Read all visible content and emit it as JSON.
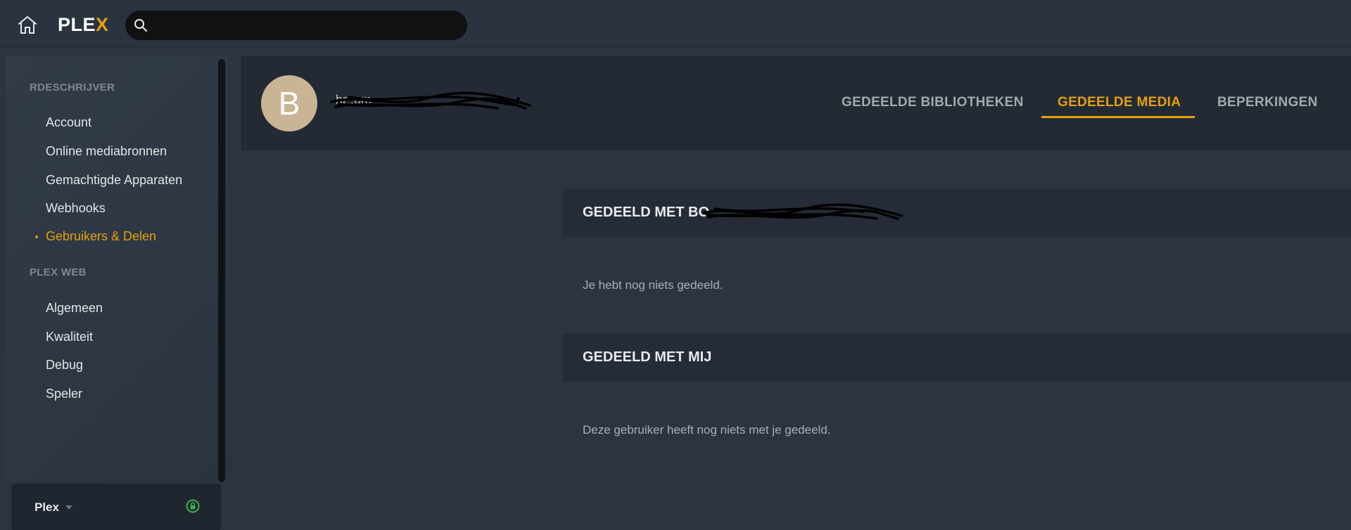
{
  "topbar": {
    "home_icon": "home-icon",
    "logo_text": "PLE",
    "logo_accent": "X",
    "search_icon": "search-icon",
    "search": {
      "value": "",
      "placeholder": ""
    }
  },
  "sidebar": {
    "section1_title": "RDESCHRIJVER",
    "section1_items": [
      {
        "label": "Account"
      },
      {
        "label": "Online mediabronnen"
      },
      {
        "label": "Gemachtigde Apparaten"
      },
      {
        "label": "Webhooks"
      },
      {
        "label": "Gebruikers & Delen",
        "active": true
      }
    ],
    "section2_title": "PLEX WEB",
    "section2_items": [
      {
        "label": "Algemeen"
      },
      {
        "label": "Kwaliteit"
      },
      {
        "label": "Debug"
      },
      {
        "label": "Speler"
      }
    ],
    "server": {
      "name": "Plex",
      "caret_icon": "caret-down-icon",
      "lock_icon": "lock-icon"
    }
  },
  "profile": {
    "avatar_letter": "B",
    "username_visible": "hr                          .om",
    "tabs": [
      {
        "label": "GEDEELDE BIBLIOTHEKEN"
      },
      {
        "label": "GEDEELDE MEDIA",
        "active": true
      },
      {
        "label": "BEPERKINGEN"
      }
    ]
  },
  "main": {
    "shared_with_title": "GEDEELD MET BO",
    "shared_with_empty": "Je hebt nog niets gedeeld.",
    "shared_with_me_title": "GEDEELD MET MIJ",
    "shared_with_me_empty": "Deze gebruiker heeft nog niets met je gedeeld."
  },
  "colors": {
    "accent": "#e5a00d",
    "background": "#2c3440",
    "header_bg": "#232a34",
    "avatar_bg": "#c9b494",
    "lock_green": "#3bb04a"
  }
}
